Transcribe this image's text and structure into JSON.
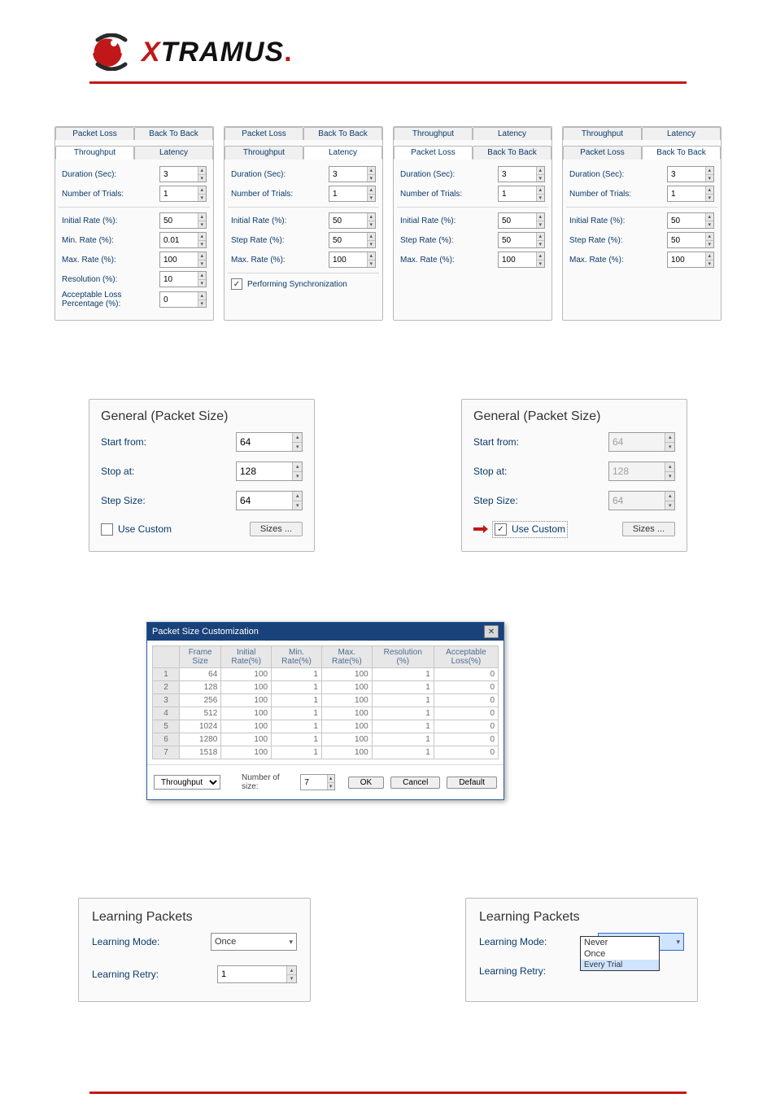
{
  "brand": {
    "name_prefix": "X",
    "name_rest": "TRAMUS",
    "trailing": "."
  },
  "panels": {
    "throughput": {
      "tab_packet_loss": "Packet Loss",
      "tab_back_to_back": "Back To Back",
      "tab_throughput": "Throughput",
      "tab_latency": "Latency",
      "duration_label": "Duration (Sec):",
      "duration_value": "3",
      "trials_label": "Number of Trials:",
      "trials_value": "1",
      "initial_label": "Initial Rate (%):",
      "initial_value": "50",
      "min_label": "Min. Rate (%):",
      "min_value": "0.01",
      "max_label": "Max. Rate (%):",
      "max_value": "100",
      "resolution_label": "Resolution (%):",
      "resolution_value": "10",
      "acc_loss_label": "Acceptable Loss\nPercentage (%):",
      "acc_loss_value": "0"
    },
    "latency": {
      "duration_value": "3",
      "trials_value": "1",
      "initial_value": "50",
      "step_label": "Step Rate (%):",
      "step_value": "50",
      "max_value": "100",
      "sync_label": "Performing Synchronization"
    },
    "packet_loss": {
      "duration_value": "3",
      "trials_value": "1",
      "initial_value": "50",
      "step_value": "50",
      "max_value": "100"
    },
    "back_to_back": {
      "duration_value": "3",
      "trials_value": "1",
      "initial_value": "50",
      "step_value": "50",
      "max_value": "100"
    }
  },
  "packet_size": {
    "legend": "General (Packet Size)",
    "start_label": "Start from:",
    "stop_label": "Stop at:",
    "step_label": "Step Size:",
    "start": "64",
    "stop": "128",
    "step": "64",
    "use_custom_label": "Use Custom",
    "sizes_btn": "Sizes ..."
  },
  "psc": {
    "title": "Packet Size Customization",
    "columns": [
      "",
      "Frame\nSize",
      "Initial\nRate(%)",
      "Min.\nRate(%)",
      "Max.\nRate(%)",
      "Resolution\n(%)",
      "Acceptable\nLoss(%)"
    ],
    "rows": [
      {
        "i": "1",
        "frame": "64",
        "init": "100",
        "min": "1",
        "max": "100",
        "res": "1",
        "loss": "0"
      },
      {
        "i": "2",
        "frame": "128",
        "init": "100",
        "min": "1",
        "max": "100",
        "res": "1",
        "loss": "0"
      },
      {
        "i": "3",
        "frame": "256",
        "init": "100",
        "min": "1",
        "max": "100",
        "res": "1",
        "loss": "0"
      },
      {
        "i": "4",
        "frame": "512",
        "init": "100",
        "min": "1",
        "max": "100",
        "res": "1",
        "loss": "0"
      },
      {
        "i": "5",
        "frame": "1024",
        "init": "100",
        "min": "1",
        "max": "100",
        "res": "1",
        "loss": "0"
      },
      {
        "i": "6",
        "frame": "1280",
        "init": "100",
        "min": "1",
        "max": "100",
        "res": "1",
        "loss": "0"
      },
      {
        "i": "7",
        "frame": "1518",
        "init": "100",
        "min": "1",
        "max": "100",
        "res": "1",
        "loss": "0"
      }
    ],
    "mode_select": "Throughput",
    "num_size_label": "Number of size:",
    "num_size_value": "7",
    "ok": "OK",
    "cancel": "Cancel",
    "default": "Default"
  },
  "learning": {
    "legend": "Learning Packets",
    "mode_label": "Learning Mode:",
    "retry_label": "Learning Retry:",
    "mode_value": "Once",
    "retry_value": "1",
    "options": [
      "Never",
      "Once",
      "Every Trial"
    ]
  }
}
